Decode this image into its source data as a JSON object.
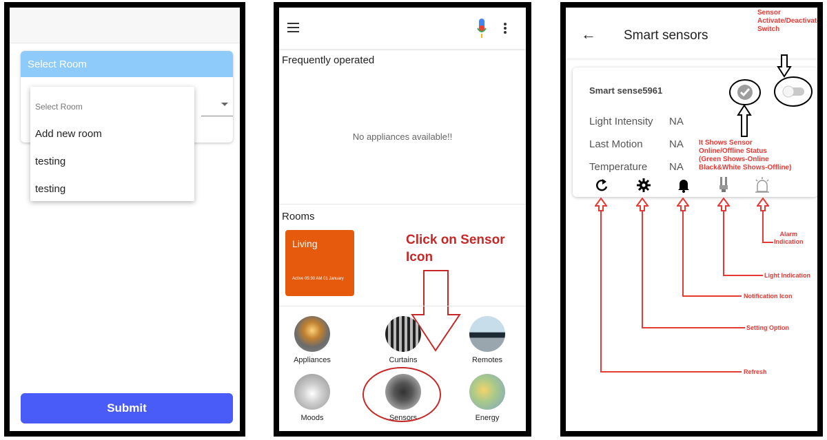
{
  "panel1": {
    "card_header": "Select Room",
    "dropdown": {
      "hint": "Select Room",
      "options": [
        "Add new room",
        "testing",
        "testing"
      ]
    },
    "submit_label": "Submit"
  },
  "panel2": {
    "frequently_operated": "Frequently operated",
    "empty_message": "No appliances available!!",
    "rooms_heading": "Rooms",
    "room_card": {
      "name": "Living",
      "status": "Active 05:30 AM 01 January"
    },
    "callout": "Click on Sensor Icon",
    "tiles": [
      {
        "label": "Appliances",
        "icon": "bulb-image"
      },
      {
        "label": "Curtains",
        "icon": "curtains-image"
      },
      {
        "label": "Remotes",
        "icon": "remote-image"
      },
      {
        "label": "Moods",
        "icon": "moods-image"
      },
      {
        "label": "Sensors",
        "icon": "sensor-image"
      },
      {
        "label": "Energy",
        "icon": "energy-image"
      }
    ]
  },
  "panel3": {
    "title": "Smart sensors",
    "sensor_name": "Smart sense5961",
    "readings": [
      {
        "label": "Light Intensity",
        "value": "NA"
      },
      {
        "label": "Last Motion",
        "value": "NA"
      },
      {
        "label": "Temperature",
        "value": "NA"
      }
    ],
    "annotations": {
      "switch_note": [
        "Sensor",
        "Activate/Deactivate",
        "Switch"
      ],
      "status_note": [
        "It Shows Sensor",
        "Online/Offline Status",
        "(Green Shows-Online",
        "Black&White Shows-Offline)"
      ],
      "alarm": [
        "Alarm",
        "Indication"
      ],
      "light": "Light Indication",
      "notification": "Notification Icon",
      "setting": "Setting Option",
      "refresh": "Refresh"
    },
    "colors": {
      "annotation": "#e53935",
      "accent": "#4a5cf7",
      "room_card": "#e65a0e",
      "header_blue": "#8ecbfb"
    }
  }
}
